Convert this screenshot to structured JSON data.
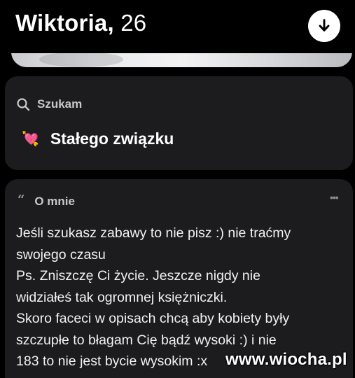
{
  "header": {
    "name": "Wiktoria,",
    "age": "26"
  },
  "looking_for": {
    "label": "Szukam",
    "icon": "search-icon",
    "value": "Stałego związku",
    "value_icon": "heart-with-arrow-icon"
  },
  "about": {
    "label": "O mnie",
    "icon": "quote-icon",
    "more_icon": "more-dots-icon",
    "text": "Jeśli szukasz zabawy to nie pisz :) nie traćmy\nswojego czasu\nPs. Zniszczę Ci życie. Jeszcze nigdy nie\nwidziałeś tak ogromnej księżniczki.\nSkoro faceci w opisach chcą aby kobiety były\nszczupłe to błagam Cię bądź wysoki :) i nie\n183 to nie jest bycie wysokim :x"
  },
  "watermark": "www.wiocha.pl",
  "colors": {
    "background": "#000000",
    "card": "#1c1c1e",
    "text": "#ffffff",
    "muted": "#c8c8cc"
  }
}
